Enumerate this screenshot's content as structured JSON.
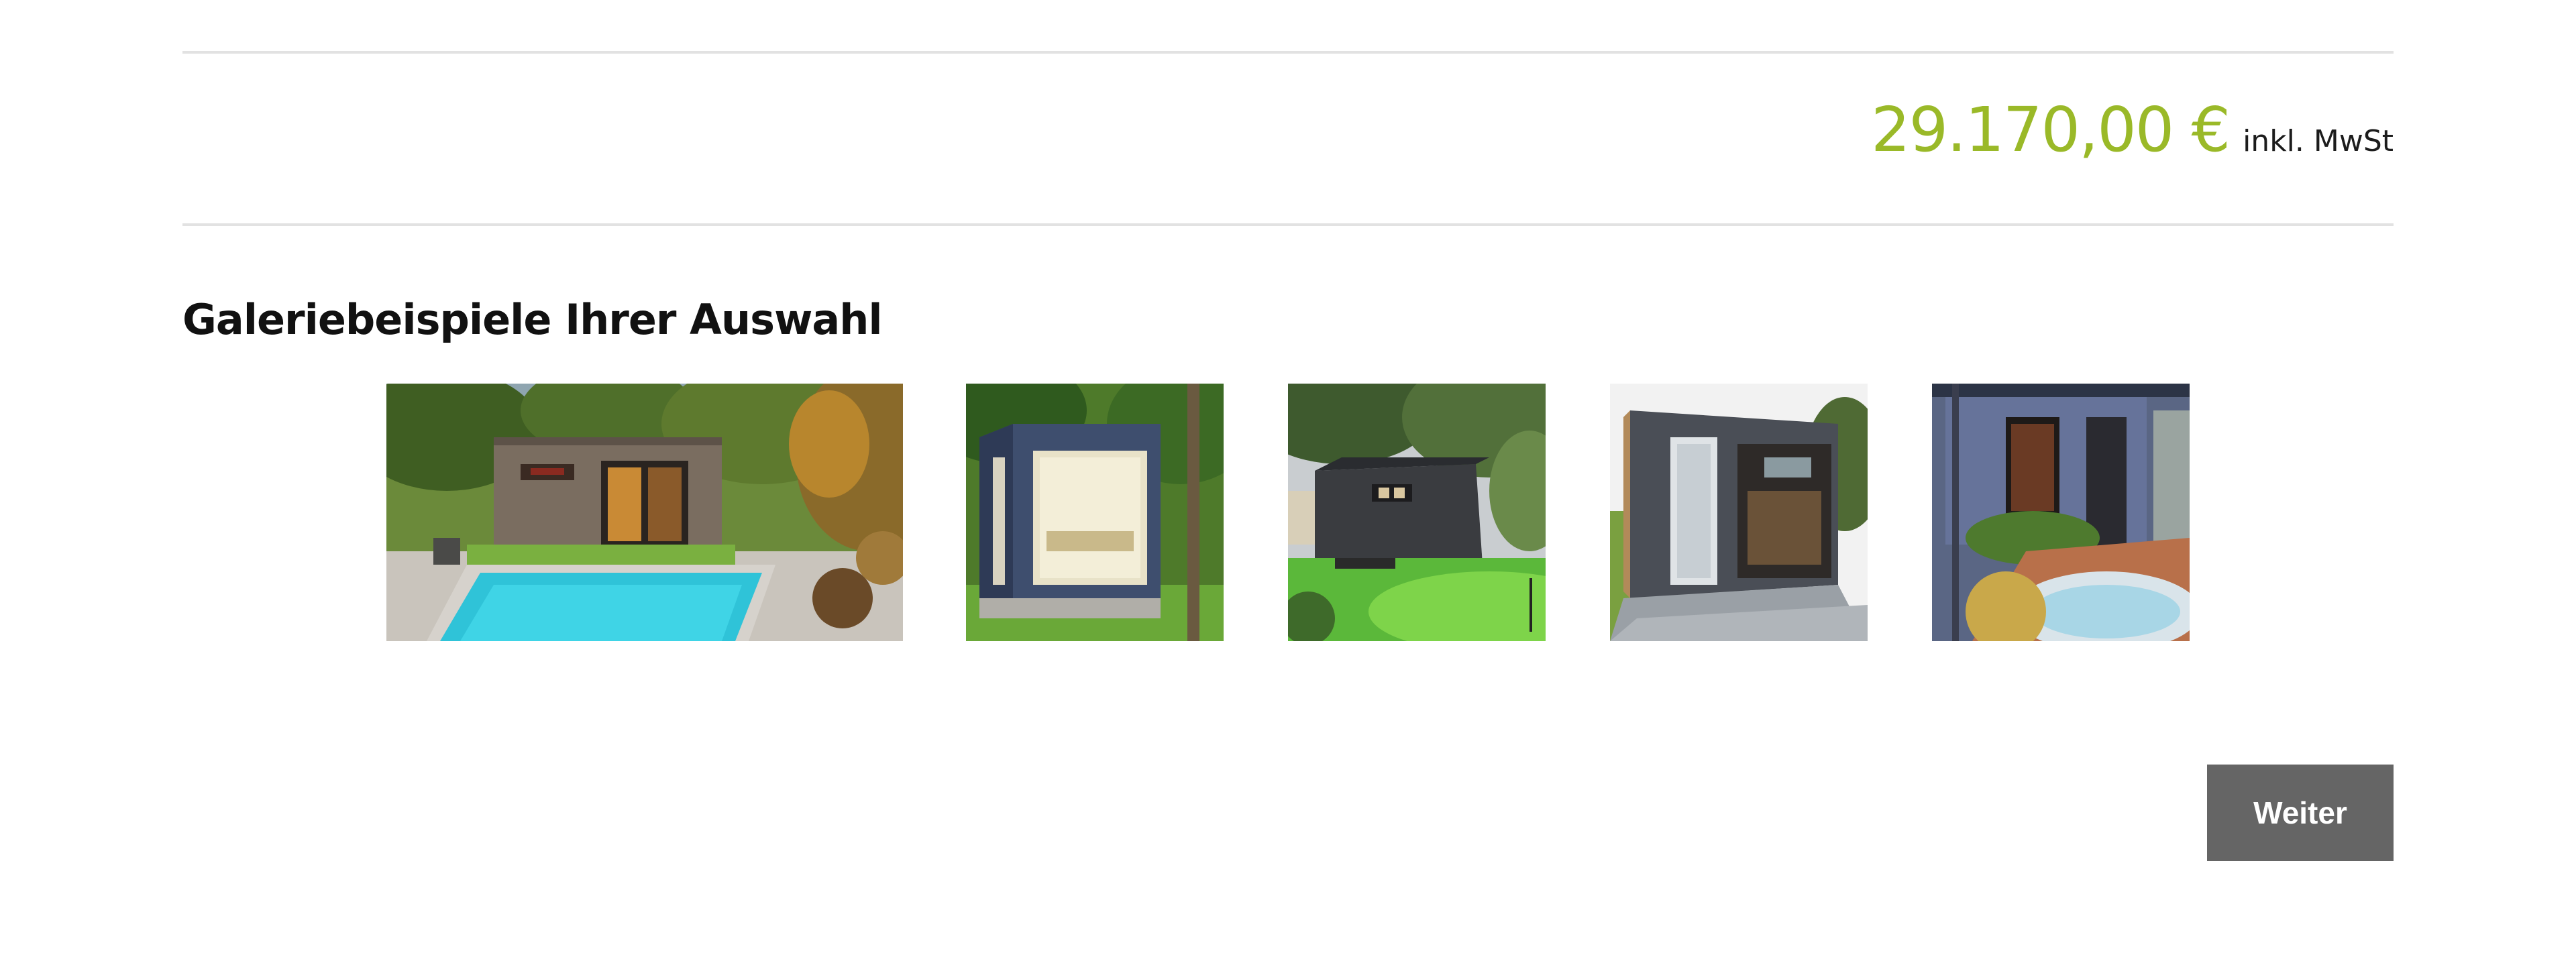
{
  "price": {
    "value": "29.170,00 €",
    "note": "inkl. MwSt",
    "color": "#9ab928"
  },
  "gallery": {
    "heading": "Galeriebeispiele Ihrer Auswahl",
    "images": [
      {
        "subject": "garden-house-with-pool"
      },
      {
        "subject": "blue-sauna-cube"
      },
      {
        "subject": "dark-garden-cube-with-putting-green"
      },
      {
        "subject": "grey-garden-studio-on-patio"
      },
      {
        "subject": "blue-garden-room-with-hot-tub"
      }
    ]
  },
  "actions": {
    "next_label": "Weiter",
    "button_color": "#656565"
  }
}
